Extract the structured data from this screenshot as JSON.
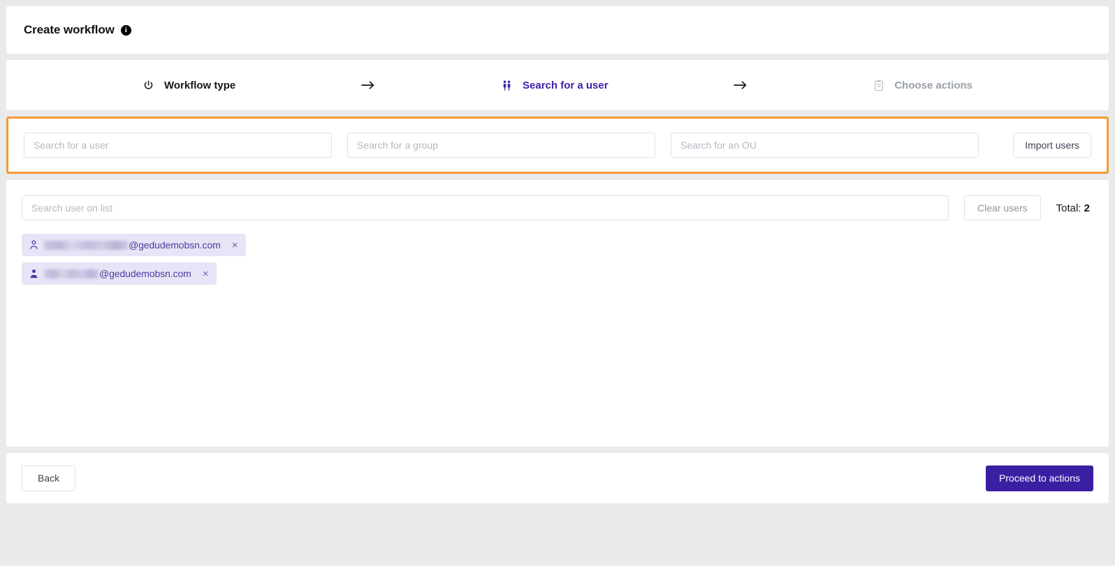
{
  "header": {
    "title": "Create workflow",
    "info_icon": "info-icon",
    "info_glyph": "i"
  },
  "stepper": {
    "arrow_glyph": "→",
    "steps": [
      {
        "label": "Workflow type",
        "icon": "power-icon",
        "state": "done"
      },
      {
        "label": "Search for a user",
        "icon": "people-icon",
        "state": "active"
      },
      {
        "label": "Choose actions",
        "icon": "clipboard-icon",
        "state": "todo"
      }
    ]
  },
  "search_panel": {
    "highlight_color": "#f59a34",
    "user_placeholder": "Search for a user",
    "user_value": "",
    "group_placeholder": "Search for a group",
    "group_value": "",
    "ou_placeholder": "Search for an OU",
    "ou_value": "",
    "import_label": "Import users"
  },
  "user_list": {
    "search_placeholder": "Search user on list",
    "search_value": "",
    "clear_label": "Clear users",
    "total_label": "Total:",
    "total_count": "2",
    "close_glyph": "×",
    "chips": [
      {
        "icon": "user-outline-icon",
        "redacted": true,
        "domain": "@gedudemobsn.com"
      },
      {
        "icon": "user-filled-icon",
        "redacted": true,
        "domain": "@gedudemobsn.com"
      }
    ]
  },
  "footer": {
    "back_label": "Back",
    "proceed_label": "Proceed to actions",
    "proceed_color": "#3b1fa3"
  }
}
